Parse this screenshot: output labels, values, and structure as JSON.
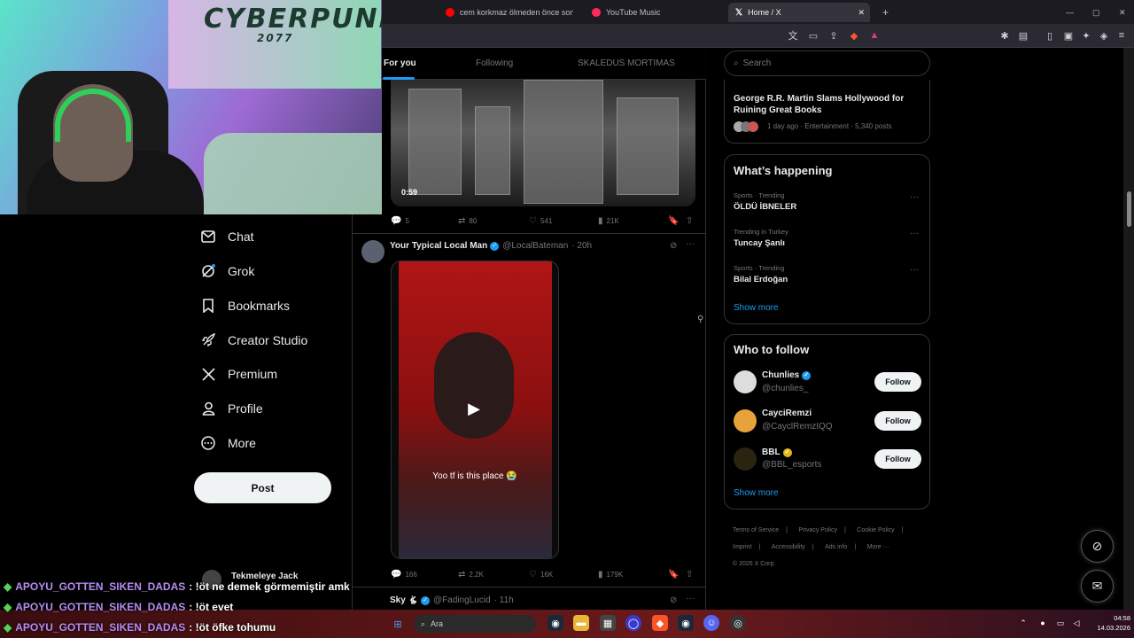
{
  "browser": {
    "tabs": [
      {
        "label": "cem korkmaz ölmeden önce son cara",
        "active": false,
        "icon": "youtube-icon"
      },
      {
        "label": "YouTube Music",
        "active": false,
        "icon": "youtube-music-icon"
      },
      {
        "label": "Home / X",
        "active": true,
        "icon": "x-logo-icon"
      }
    ],
    "new_tab": "+",
    "window_controls": [
      "—",
      "▢",
      "✕"
    ]
  },
  "webcam": {
    "poster_text": "CYBERPUNK",
    "poster_sub": "2077"
  },
  "nav": {
    "items": [
      {
        "label": "Chat",
        "icon": "mail-icon"
      },
      {
        "label": "Grok",
        "icon": "grok-icon"
      },
      {
        "label": "Bookmarks",
        "icon": "bookmark-icon"
      },
      {
        "label": "Creator Studio",
        "icon": "rocket-icon"
      },
      {
        "label": "Premium",
        "icon": "x-logo-icon"
      },
      {
        "label": "Profile",
        "icon": "person-icon"
      },
      {
        "label": "More",
        "icon": "more-circle-icon"
      }
    ],
    "post_label": "Post",
    "account_name": "Tekmeleye Jack"
  },
  "feed": {
    "tabs": [
      "For you",
      "Following",
      "SKALEDUS MORTIMAS"
    ],
    "tweet1": {
      "video_duration": "0:59",
      "replies": "5",
      "reposts": "80",
      "likes": "541",
      "views": "21K"
    },
    "tweet2": {
      "name": "Your Typical Local Man",
      "handle": "@LocalBateman",
      "time": "· 20h",
      "caption": "Yoo tf is this place 😭",
      "replies": "166",
      "reposts": "2.2K",
      "likes": "16K",
      "views": "179K"
    },
    "tweet3": {
      "name": "Sky",
      "name_emoji": "🐇",
      "handle": "@FadingLucid",
      "time": "· 11h"
    }
  },
  "sidebar": {
    "search_placeholder": "Search",
    "news": {
      "headline": "George R.R. Martin Slams Hollywood for Ruining Great Books",
      "meta": "1 day ago · Entertainment · 5,340 posts"
    },
    "happening": {
      "title": "What’s happening",
      "trends": [
        {
          "category": "Sports · Trending",
          "name": "ÖLDÜ İBNELER"
        },
        {
          "category": "Trending in Turkey",
          "name": "Tuncay Şanlı"
        },
        {
          "category": "Sports · Trending",
          "name": "Bilal Erdoğan"
        }
      ],
      "show_more": "Show more"
    },
    "who_to_follow": {
      "title": "Who to follow",
      "accounts": [
        {
          "name": "Chunlies",
          "handle": "@chunlies_",
          "badge": "blue"
        },
        {
          "name": "CayciRemzi",
          "handle": "@CayclRemzIQQ",
          "badge": "none"
        },
        {
          "name": "BBL",
          "handle": "@BBL_esports",
          "badge": "gold"
        }
      ],
      "follow_label": "Follow",
      "show_more": "Show more"
    },
    "footer": {
      "links": [
        "Terms of Service",
        "|",
        "Privacy Policy",
        "|",
        "Cookie Policy",
        "|",
        "Imprint",
        "|",
        "Accessibility",
        "|",
        "Ads info",
        "|",
        "More ···"
      ],
      "copyright": "© 2026 X Corp."
    }
  },
  "chat": [
    {
      "user": "APOYU_GOTTEN_SIKEN_DADAS",
      "message": ": !öt ne demek görmemiştir amk"
    },
    {
      "user": "APOYU_GOTTEN_SIKEN_DADAS",
      "message": ": !öt evet"
    },
    {
      "user": "APOYU_GOTTEN_SIKEN_DADAS",
      "message": ": !öt öfke tohumu"
    }
  ],
  "taskbar": {
    "search_placeholder": "Ara",
    "time": "04:58",
    "date": "14.03.2026"
  },
  "colors": {
    "accent": "#1d9bf0",
    "background": "#000000",
    "chat_user": "#b48cf0"
  }
}
